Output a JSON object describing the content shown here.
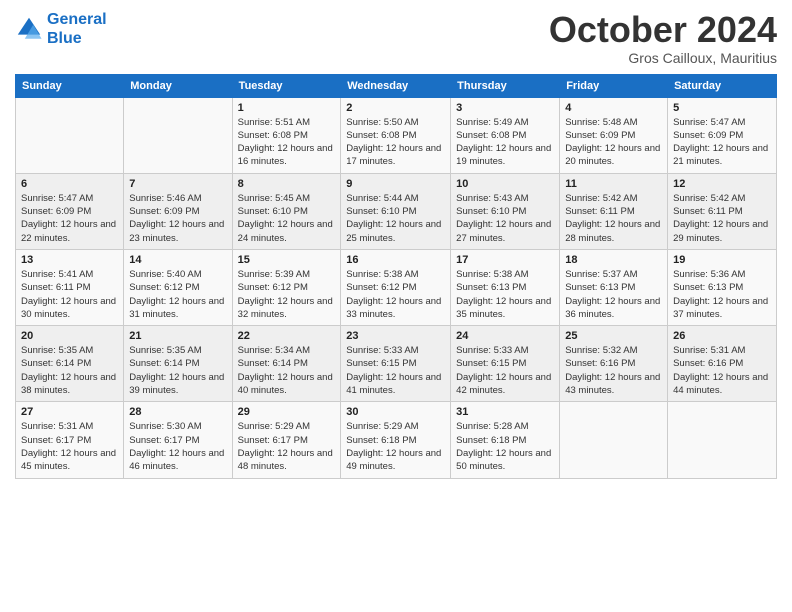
{
  "logo": {
    "line1": "General",
    "line2": "Blue"
  },
  "title": "October 2024",
  "subtitle": "Gros Cailloux, Mauritius",
  "days_of_week": [
    "Sunday",
    "Monday",
    "Tuesday",
    "Wednesday",
    "Thursday",
    "Friday",
    "Saturday"
  ],
  "weeks": [
    [
      {
        "day": "",
        "sunrise": "",
        "sunset": "",
        "daylight": ""
      },
      {
        "day": "",
        "sunrise": "",
        "sunset": "",
        "daylight": ""
      },
      {
        "day": "1",
        "sunrise": "Sunrise: 5:51 AM",
        "sunset": "Sunset: 6:08 PM",
        "daylight": "Daylight: 12 hours and 16 minutes."
      },
      {
        "day": "2",
        "sunrise": "Sunrise: 5:50 AM",
        "sunset": "Sunset: 6:08 PM",
        "daylight": "Daylight: 12 hours and 17 minutes."
      },
      {
        "day": "3",
        "sunrise": "Sunrise: 5:49 AM",
        "sunset": "Sunset: 6:08 PM",
        "daylight": "Daylight: 12 hours and 19 minutes."
      },
      {
        "day": "4",
        "sunrise": "Sunrise: 5:48 AM",
        "sunset": "Sunset: 6:09 PM",
        "daylight": "Daylight: 12 hours and 20 minutes."
      },
      {
        "day": "5",
        "sunrise": "Sunrise: 5:47 AM",
        "sunset": "Sunset: 6:09 PM",
        "daylight": "Daylight: 12 hours and 21 minutes."
      }
    ],
    [
      {
        "day": "6",
        "sunrise": "Sunrise: 5:47 AM",
        "sunset": "Sunset: 6:09 PM",
        "daylight": "Daylight: 12 hours and 22 minutes."
      },
      {
        "day": "7",
        "sunrise": "Sunrise: 5:46 AM",
        "sunset": "Sunset: 6:09 PM",
        "daylight": "Daylight: 12 hours and 23 minutes."
      },
      {
        "day": "8",
        "sunrise": "Sunrise: 5:45 AM",
        "sunset": "Sunset: 6:10 PM",
        "daylight": "Daylight: 12 hours and 24 minutes."
      },
      {
        "day": "9",
        "sunrise": "Sunrise: 5:44 AM",
        "sunset": "Sunset: 6:10 PM",
        "daylight": "Daylight: 12 hours and 25 minutes."
      },
      {
        "day": "10",
        "sunrise": "Sunrise: 5:43 AM",
        "sunset": "Sunset: 6:10 PM",
        "daylight": "Daylight: 12 hours and 27 minutes."
      },
      {
        "day": "11",
        "sunrise": "Sunrise: 5:42 AM",
        "sunset": "Sunset: 6:11 PM",
        "daylight": "Daylight: 12 hours and 28 minutes."
      },
      {
        "day": "12",
        "sunrise": "Sunrise: 5:42 AM",
        "sunset": "Sunset: 6:11 PM",
        "daylight": "Daylight: 12 hours and 29 minutes."
      }
    ],
    [
      {
        "day": "13",
        "sunrise": "Sunrise: 5:41 AM",
        "sunset": "Sunset: 6:11 PM",
        "daylight": "Daylight: 12 hours and 30 minutes."
      },
      {
        "day": "14",
        "sunrise": "Sunrise: 5:40 AM",
        "sunset": "Sunset: 6:12 PM",
        "daylight": "Daylight: 12 hours and 31 minutes."
      },
      {
        "day": "15",
        "sunrise": "Sunrise: 5:39 AM",
        "sunset": "Sunset: 6:12 PM",
        "daylight": "Daylight: 12 hours and 32 minutes."
      },
      {
        "day": "16",
        "sunrise": "Sunrise: 5:38 AM",
        "sunset": "Sunset: 6:12 PM",
        "daylight": "Daylight: 12 hours and 33 minutes."
      },
      {
        "day": "17",
        "sunrise": "Sunrise: 5:38 AM",
        "sunset": "Sunset: 6:13 PM",
        "daylight": "Daylight: 12 hours and 35 minutes."
      },
      {
        "day": "18",
        "sunrise": "Sunrise: 5:37 AM",
        "sunset": "Sunset: 6:13 PM",
        "daylight": "Daylight: 12 hours and 36 minutes."
      },
      {
        "day": "19",
        "sunrise": "Sunrise: 5:36 AM",
        "sunset": "Sunset: 6:13 PM",
        "daylight": "Daylight: 12 hours and 37 minutes."
      }
    ],
    [
      {
        "day": "20",
        "sunrise": "Sunrise: 5:35 AM",
        "sunset": "Sunset: 6:14 PM",
        "daylight": "Daylight: 12 hours and 38 minutes."
      },
      {
        "day": "21",
        "sunrise": "Sunrise: 5:35 AM",
        "sunset": "Sunset: 6:14 PM",
        "daylight": "Daylight: 12 hours and 39 minutes."
      },
      {
        "day": "22",
        "sunrise": "Sunrise: 5:34 AM",
        "sunset": "Sunset: 6:14 PM",
        "daylight": "Daylight: 12 hours and 40 minutes."
      },
      {
        "day": "23",
        "sunrise": "Sunrise: 5:33 AM",
        "sunset": "Sunset: 6:15 PM",
        "daylight": "Daylight: 12 hours and 41 minutes."
      },
      {
        "day": "24",
        "sunrise": "Sunrise: 5:33 AM",
        "sunset": "Sunset: 6:15 PM",
        "daylight": "Daylight: 12 hours and 42 minutes."
      },
      {
        "day": "25",
        "sunrise": "Sunrise: 5:32 AM",
        "sunset": "Sunset: 6:16 PM",
        "daylight": "Daylight: 12 hours and 43 minutes."
      },
      {
        "day": "26",
        "sunrise": "Sunrise: 5:31 AM",
        "sunset": "Sunset: 6:16 PM",
        "daylight": "Daylight: 12 hours and 44 minutes."
      }
    ],
    [
      {
        "day": "27",
        "sunrise": "Sunrise: 5:31 AM",
        "sunset": "Sunset: 6:17 PM",
        "daylight": "Daylight: 12 hours and 45 minutes."
      },
      {
        "day": "28",
        "sunrise": "Sunrise: 5:30 AM",
        "sunset": "Sunset: 6:17 PM",
        "daylight": "Daylight: 12 hours and 46 minutes."
      },
      {
        "day": "29",
        "sunrise": "Sunrise: 5:29 AM",
        "sunset": "Sunset: 6:17 PM",
        "daylight": "Daylight: 12 hours and 48 minutes."
      },
      {
        "day": "30",
        "sunrise": "Sunrise: 5:29 AM",
        "sunset": "Sunset: 6:18 PM",
        "daylight": "Daylight: 12 hours and 49 minutes."
      },
      {
        "day": "31",
        "sunrise": "Sunrise: 5:28 AM",
        "sunset": "Sunset: 6:18 PM",
        "daylight": "Daylight: 12 hours and 50 minutes."
      },
      {
        "day": "",
        "sunrise": "",
        "sunset": "",
        "daylight": ""
      },
      {
        "day": "",
        "sunrise": "",
        "sunset": "",
        "daylight": ""
      }
    ]
  ]
}
